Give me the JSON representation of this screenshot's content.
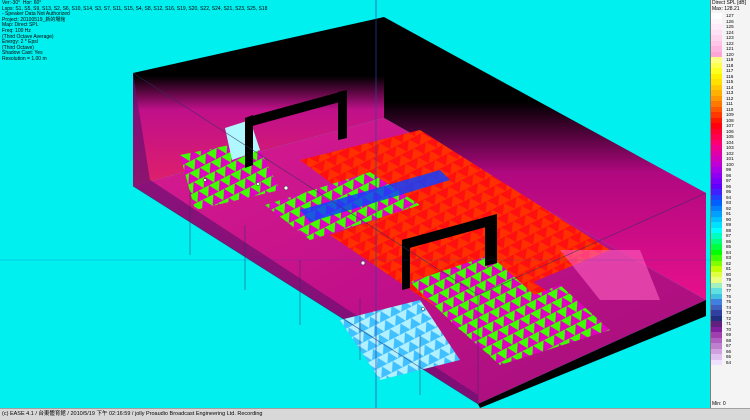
{
  "info_lines": [
    "Ver:-30°  Hor: 60°",
    "Lsps: S1, S5, S9, S13, S2, S6, S10, S14, S3, S7, S11, S15, S4, S8, S12, S16, S19, S20, S22, S24, S21, S23, S25, S18",
    "- Speaker Data Not Authorized",
    "Project: 20100519_新的場館",
    "Map: Direct SPL",
    "Freq: 100 Hz",
    "(Third Octave Average)",
    "Energy: 2 * Epsl",
    "(Third Octave)",
    "Shadow Cast: Yes",
    "Resolution = 1.00 m"
  ],
  "legend": {
    "title": "Direct SPL [dB]",
    "max_label": "Max: 128.21",
    "min_label": "Min: 0",
    "entries": [
      {
        "value": "127",
        "color": "#ffffff"
      },
      {
        "value": "126",
        "color": "#fff6fc"
      },
      {
        "value": "125",
        "color": "#ffecf8"
      },
      {
        "value": "124",
        "color": "#ffe0f4"
      },
      {
        "value": "123",
        "color": "#ffd2ee"
      },
      {
        "value": "122",
        "color": "#ffc4e8"
      },
      {
        "value": "121",
        "color": "#ffb4e0"
      },
      {
        "value": "120",
        "color": "#ffa4d6"
      },
      {
        "value": "119",
        "color": "#ffff80"
      },
      {
        "value": "118",
        "color": "#ffff50"
      },
      {
        "value": "117",
        "color": "#ffff20"
      },
      {
        "value": "116",
        "color": "#fff000"
      },
      {
        "value": "115",
        "color": "#ffe000"
      },
      {
        "value": "114",
        "color": "#ffc800"
      },
      {
        "value": "113",
        "color": "#ffb000"
      },
      {
        "value": "112",
        "color": "#ff9800"
      },
      {
        "value": "111",
        "color": "#ff7800"
      },
      {
        "value": "110",
        "color": "#ff5800"
      },
      {
        "value": "109",
        "color": "#ff3800"
      },
      {
        "value": "108",
        "color": "#ff1800"
      },
      {
        "value": "107",
        "color": "#ff0010"
      },
      {
        "value": "106",
        "color": "#ff0030"
      },
      {
        "value": "105",
        "color": "#ff0050"
      },
      {
        "value": "104",
        "color": "#ff0070"
      },
      {
        "value": "103",
        "color": "#f00090"
      },
      {
        "value": "102",
        "color": "#e000a8"
      },
      {
        "value": "101",
        "color": "#d000c0"
      },
      {
        "value": "100",
        "color": "#c000d8"
      },
      {
        "value": "99",
        "color": "#a800e8"
      },
      {
        "value": "98",
        "color": "#9000f0"
      },
      {
        "value": "97",
        "color": "#7800f8"
      },
      {
        "value": "96",
        "color": "#6000ff"
      },
      {
        "value": "95",
        "color": "#4020ff"
      },
      {
        "value": "94",
        "color": "#2040ff"
      },
      {
        "value": "93",
        "color": "#0060ff"
      },
      {
        "value": "92",
        "color": "#0080ff"
      },
      {
        "value": "91",
        "color": "#00a0ff"
      },
      {
        "value": "90",
        "color": "#00c0ff"
      },
      {
        "value": "89",
        "color": "#00e0ff"
      },
      {
        "value": "88",
        "color": "#00ffff"
      },
      {
        "value": "87",
        "color": "#00ffc0"
      },
      {
        "value": "86",
        "color": "#00ff80"
      },
      {
        "value": "85",
        "color": "#00ff40"
      },
      {
        "value": "84",
        "color": "#00ff00"
      },
      {
        "value": "83",
        "color": "#40ff00"
      },
      {
        "value": "82",
        "color": "#80ff00"
      },
      {
        "value": "81",
        "color": "#c0ff00"
      },
      {
        "value": "80",
        "color": "#e0ff40"
      },
      {
        "value": "79",
        "color": "#e8ff80"
      },
      {
        "value": "78",
        "color": "#a0f0c0"
      },
      {
        "value": "77",
        "color": "#60e0e0"
      },
      {
        "value": "76",
        "color": "#40c0e0"
      },
      {
        "value": "75",
        "color": "#4080e0"
      },
      {
        "value": "74",
        "color": "#4060c0"
      },
      {
        "value": "73",
        "color": "#3040a0"
      },
      {
        "value": "72",
        "color": "#203080"
      },
      {
        "value": "71",
        "color": "#602080"
      },
      {
        "value": "70",
        "color": "#8020a0"
      },
      {
        "value": "69",
        "color": "#a040b0"
      },
      {
        "value": "68",
        "color": "#b060c0"
      },
      {
        "value": "67",
        "color": "#c080d0"
      },
      {
        "value": "66",
        "color": "#d0a0e0"
      },
      {
        "value": "65",
        "color": "#e0c0f0"
      },
      {
        "value": "64",
        "color": "#f0e0ff"
      }
    ]
  },
  "status_bar": "(c) EASE 4.1  / 台東體育館   / 2010/5/19 下午 02:16:59 / jolly Proaudio Broadcast Engineering Ltd. Recording"
}
